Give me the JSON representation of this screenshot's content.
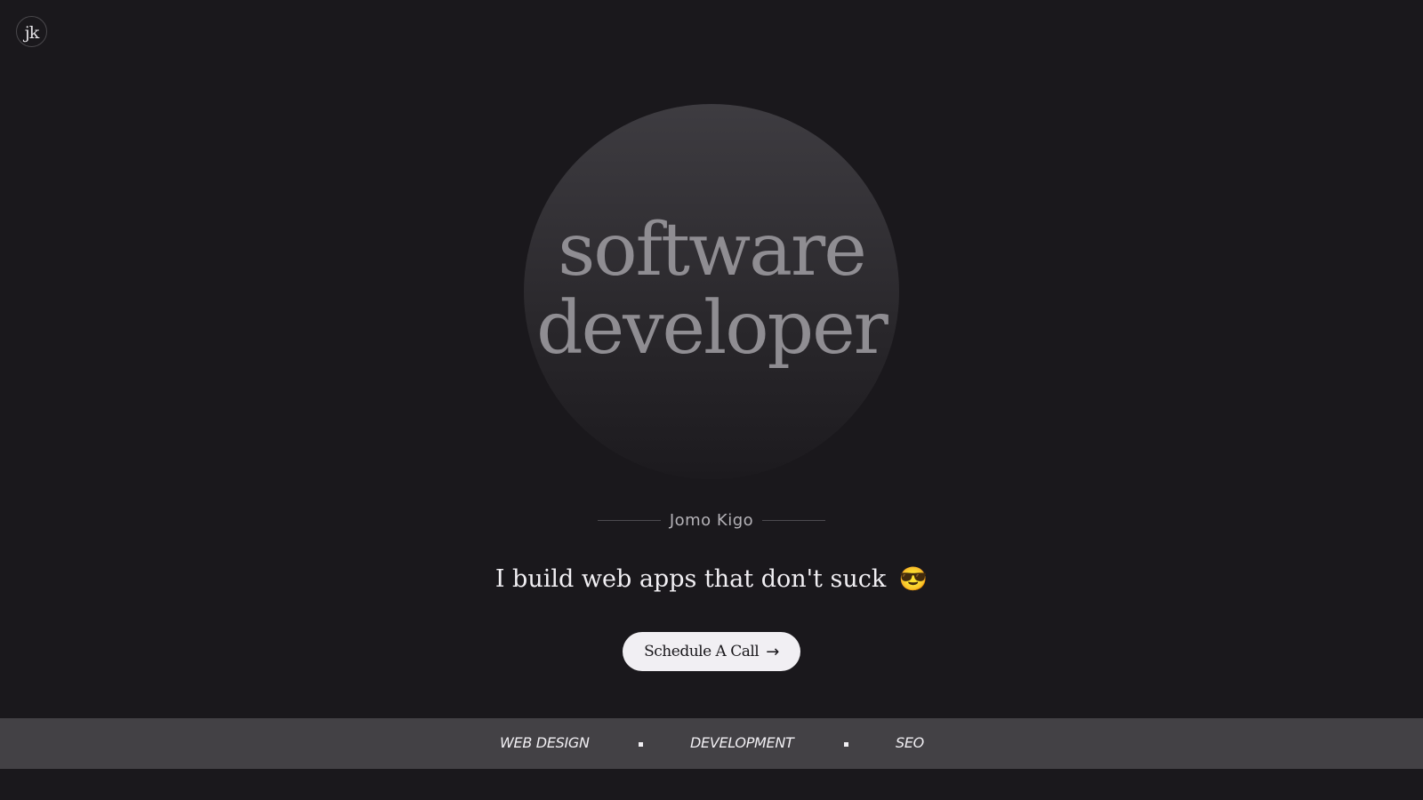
{
  "header": {
    "logo_text": "jk"
  },
  "hero": {
    "line1": "software",
    "line2": "developer"
  },
  "profile": {
    "name": "Jomo Kigo",
    "tagline": "I build web apps that don't suck",
    "tagline_emoji": "😎"
  },
  "cta": {
    "label": "Schedule A Call",
    "arrow": "→"
  },
  "services": {
    "items": [
      "WEB DESIGN",
      "DEVELOPMENT",
      "SEO"
    ]
  },
  "colors": {
    "background": "#1a181c",
    "band": "#434145",
    "button_bg": "#f1eff3",
    "hero_text": "#8f8d92"
  }
}
